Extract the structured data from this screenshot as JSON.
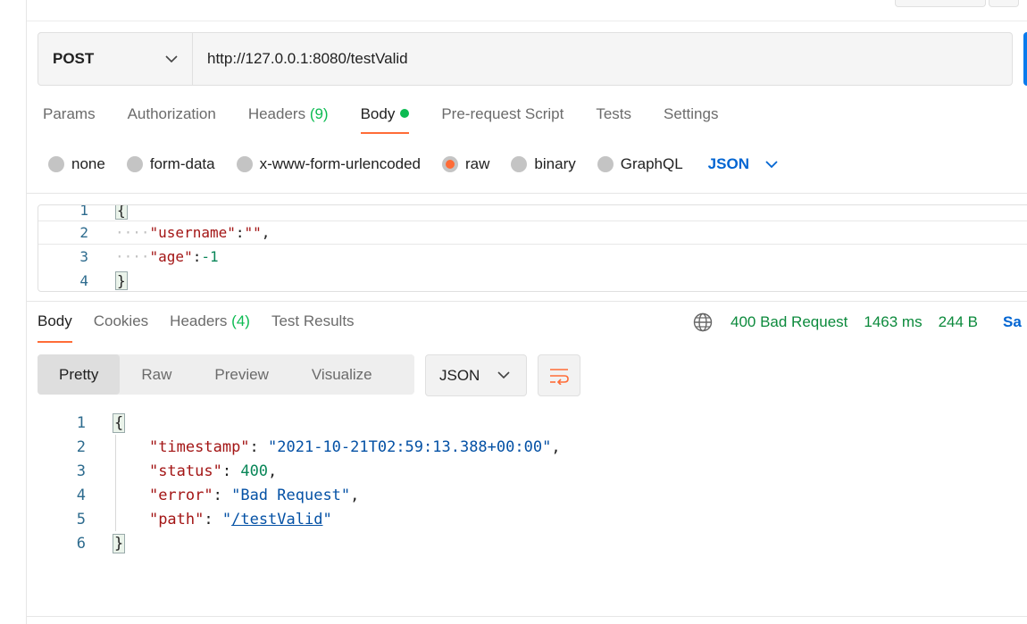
{
  "request": {
    "method": "POST",
    "url": "http://127.0.0.1:8080/testValid"
  },
  "request_tabs": [
    {
      "label": "Params"
    },
    {
      "label": "Authorization"
    },
    {
      "label": "Headers",
      "count": "(9)"
    },
    {
      "label": "Body",
      "active": true
    },
    {
      "label": "Pre-request Script"
    },
    {
      "label": "Tests"
    },
    {
      "label": "Settings"
    }
  ],
  "body_types": [
    "none",
    "form-data",
    "x-www-form-urlencoded",
    "raw",
    "binary",
    "GraphQL"
  ],
  "body_type_selected": "raw",
  "body_format": "JSON",
  "request_body": {
    "line_numbers": [
      "1",
      "2",
      "3",
      "4"
    ],
    "open_brace": "{",
    "close_brace": "}",
    "username_key": "\"username\"",
    "username_value": "\"\"",
    "age_key": "\"age\"",
    "age_value": "-1"
  },
  "response_tabs": [
    {
      "label": "Body",
      "active": true
    },
    {
      "label": "Cookies"
    },
    {
      "label": "Headers",
      "count": "(4)"
    },
    {
      "label": "Test Results"
    }
  ],
  "response_status": {
    "status": "400 Bad Request",
    "time": "1463 ms",
    "size": "244 B",
    "save": "Sa"
  },
  "view_modes": [
    "Pretty",
    "Raw",
    "Preview",
    "Visualize"
  ],
  "view_mode_selected": "Pretty",
  "response_format": "JSON",
  "response_body": {
    "line_numbers": [
      "1",
      "2",
      "3",
      "4",
      "5",
      "6"
    ],
    "open_brace": "{",
    "close_brace": "}",
    "timestamp_key": "\"timestamp\"",
    "timestamp_value": "\"2021-10-21T02:59:13.388+00:00\"",
    "status_key": "\"status\"",
    "status_value": "400",
    "error_key": "\"error\"",
    "error_value": "\"Bad Request\"",
    "path_key": "\"path\"",
    "path_value_link": "/testValid"
  },
  "colors": {
    "accent": "#ff6c37",
    "link": "#0265d2",
    "success_green": "#0cbb52",
    "status_green": "#0c8a3c"
  },
  "icons": [
    "chevron-down-icon",
    "globe-icon",
    "wrap-lines-icon"
  ]
}
